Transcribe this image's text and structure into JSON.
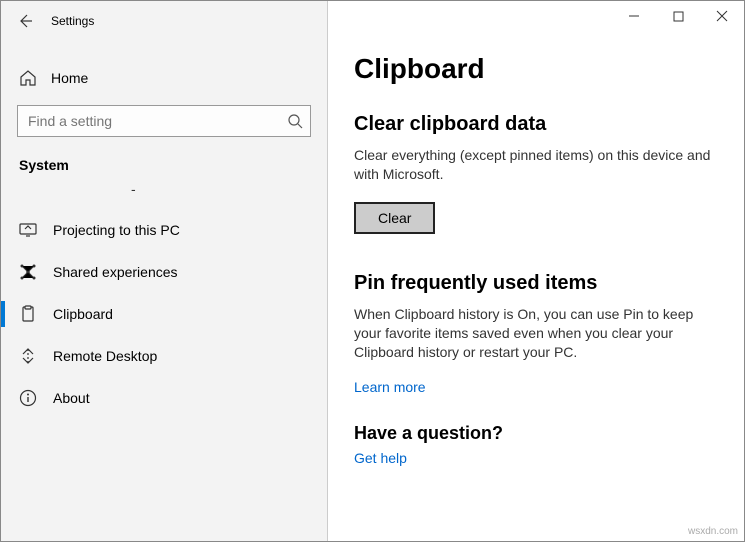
{
  "app_title": "Settings",
  "home_label": "Home",
  "search_placeholder": "Find a setting",
  "section_label": "System",
  "dash_text": "-",
  "nav": [
    {
      "icon": "projecting",
      "label": "Projecting to this PC"
    },
    {
      "icon": "shared",
      "label": "Shared experiences"
    },
    {
      "icon": "clipboard",
      "label": "Clipboard",
      "selected": true
    },
    {
      "icon": "remote",
      "label": "Remote Desktop"
    },
    {
      "icon": "about",
      "label": "About"
    }
  ],
  "page_title": "Clipboard",
  "section_clear": {
    "heading": "Clear clipboard data",
    "desc": "Clear everything (except pinned items) on this device and with Microsoft.",
    "button": "Clear"
  },
  "section_pin": {
    "heading": "Pin frequently used items",
    "desc": "When Clipboard history is On, you can use Pin to keep your favorite items saved even when you clear your Clipboard history or restart your PC.",
    "link": "Learn more"
  },
  "question": {
    "heading": "Have a question?",
    "link": "Get help"
  },
  "watermark": "wsxdn.com"
}
